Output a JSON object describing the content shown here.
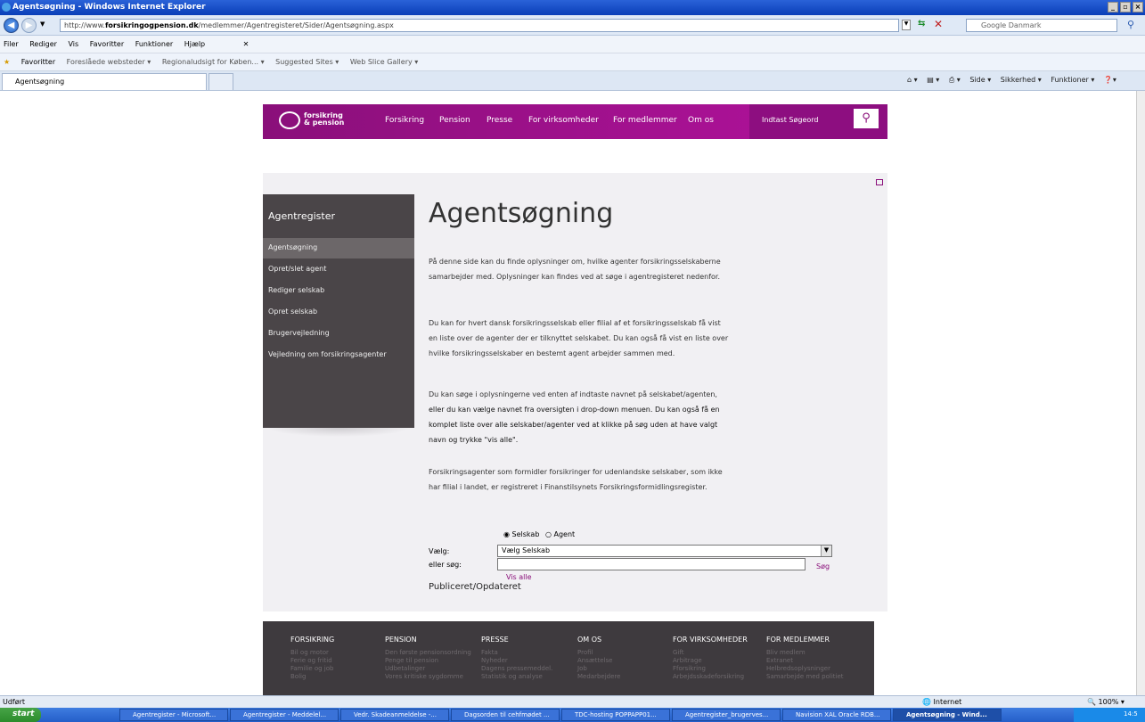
{
  "window": {
    "title": "Agentsøgning - Windows Internet Explorer"
  },
  "address": {
    "url_prefix": "http://www.",
    "url_domain": "forsikringogpension.dk",
    "url_path": "/medlemmer/Agentregisteret/Sider/Agentsøgning.aspx",
    "search_placeholder": "Google Danmark"
  },
  "menu": [
    "Filer",
    "Rediger",
    "Vis",
    "Favoritter",
    "Funktioner",
    "Hjælp"
  ],
  "favorites": {
    "label": "Favoritter",
    "items": [
      "Foreslåede websteder ▾",
      "Regionaludsigt for Køben... ▾",
      "Suggested Sites ▾",
      "Web Slice Gallery ▾"
    ]
  },
  "tab": {
    "title": "Agentsøgning"
  },
  "toolbar": [
    "Side ▾",
    "Sikkerhed ▾",
    "Funktioner ▾"
  ],
  "site": {
    "logo_line1": "forsikring",
    "logo_line2": "& pension",
    "nav": [
      "Forsikring",
      "Pension",
      "Presse",
      "For virksomheder",
      "For medlemmer",
      "Om os"
    ],
    "search_placeholder": "Indtast Søgeord"
  },
  "sidebar": {
    "heading": "Agentregister",
    "items": [
      "Agentsøgning",
      "Opret/slet agent",
      "Rediger selskab",
      "Opret selskab",
      "Brugervejledning",
      "Vejledning om forsikringsagenter"
    ]
  },
  "main": {
    "title": "Agentsøgning",
    "para1": "På denne side kan du finde oplysninger om, hvilke agenter forsikringsselskaberne samarbejder med. Oplysninger kan findes ved at søge i agentregisteret nedenfor.",
    "para2": "Du kan for hvert dansk forsikringsselskab eller filial af et forsikringsselskab få vist en liste over de agenter der er tilknyttet selskabet. Du kan også få vist en liste over hvilke forsikringsselskaber en bestemt agent arbejder sammen med.",
    "para3a": "Du kan søge i oplysningerne ved enten af indtaste navnet på selskabet/agenten, ",
    "para3b": "eller du kan vælge navnet fra oversigten i drop-down menuen. Du kan også få en komplet liste over alle selskaber/agenter ved at klikke på søg uden at have valgt navn og trykke \"vis alle\".",
    "para4": "Forsikringsagenter som formidler forsikringer for udenlandske selskaber, som ikke har filial i landet, er registreret i Finanstilsynets Forsikringsformidlingsregister."
  },
  "form": {
    "radio_selskab": "Selskab",
    "radio_agent": "Agent",
    "label_vaelg": "Vælg:",
    "select_value": "Vælg Selskab",
    "label_soeg": "eller søg:",
    "search_button": "Søg",
    "show_all": "Vis alle",
    "published": "Publiceret/Opdateret"
  },
  "footer": {
    "columns": [
      {
        "heading": "FORSIKRING",
        "items": [
          "Bil og motor",
          "Ferie og fritid",
          "Familie og job",
          "Bolig"
        ]
      },
      {
        "heading": "PENSION",
        "items": [
          "Den første pensionsordning",
          "Penge til pension",
          "Udbetalinger",
          "Vores kritiske sygdomme"
        ]
      },
      {
        "heading": "PRESSE",
        "items": [
          "Fakta",
          "Nyheder",
          "Dagens pressemeddel.",
          "Statistik og analyse"
        ]
      },
      {
        "heading": "OM OS",
        "items": [
          "Profil",
          "Ansættelse",
          "Job",
          "Medarbejdere"
        ]
      },
      {
        "heading": "FOR VIRKSOMHEDER",
        "items": [
          "Gift",
          "Arbitrage",
          "Fforsikring",
          "Arbejdsskadeforsikring"
        ]
      },
      {
        "heading": "FOR MEDLEMMER",
        "items": [
          "Bliv medlem",
          "Extranet",
          "Helbredsoplysninger",
          "Samarbejde med politiet"
        ]
      }
    ]
  },
  "status": {
    "left": "Udført",
    "zone": "Internet",
    "zoom": "100%"
  },
  "taskbar": {
    "start": "start",
    "items": [
      "Agentregister - Microsoft...",
      "Agentregister - Meddelel...",
      "Vedr. Skadeanmeldelse -...",
      "Dagsorden til cehfmødet ...",
      "TDC-hosting POPPAPP01...",
      "Agentregister_brugerves...",
      "Navision XAL Oracle RDB...",
      "Agentsøgning - Wind..."
    ],
    "clock": "14:5"
  }
}
